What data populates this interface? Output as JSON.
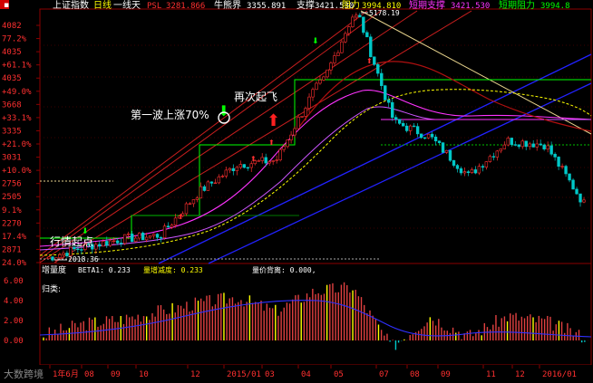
{
  "header": {
    "market": "上证指数",
    "kind": "日线",
    "period": "一线天",
    "psl_label": "PSL",
    "psl_value": "3281.866",
    "niuxiong_label": "牛熊界",
    "niuxiong_value": "3355.891",
    "support_label": "支撑",
    "support_value": "3421.530",
    "resistance_label": "阻力",
    "resistance_value": "3994.810",
    "short_support_label": "短期支撑",
    "short_support_value": "3421.530",
    "short_resist_label": "短期阻力",
    "short_resist_value": "3994.8"
  },
  "main_panel": {
    "y_ticks": [
      "4082",
      "77.2%",
      "4035",
      "61.1%",
      "4035",
      "49.0%",
      "3668",
      "33.1%",
      "3335",
      "21.0%",
      "3031",
      "10.0%",
      "2756",
      "2505",
      "9.1%",
      "2270",
      "17.4%",
      "2871",
      "24.0%"
    ],
    "annotations": {
      "wave1": "第一波上涨70%",
      "takeoff": "再次起飞",
      "start": "行情起点",
      "peak_value": "5178.19",
      "low_value": "2018.36"
    }
  },
  "sub_panel": {
    "title": "增量度",
    "beta_label": "BETA1: 0.233",
    "decrease_label": "量增减度: 0.233",
    "divergence_label": "量价背离: 0.000,",
    "class_label": "归类:",
    "y_ticks": [
      "6.00",
      "4.00",
      "2.00",
      "0.00"
    ]
  },
  "x_axis": {
    "labels": [
      "1年6月",
      "08",
      "09",
      "10",
      "12",
      "2015/01",
      "03",
      "04",
      "05",
      "07",
      "08",
      "09",
      "11",
      "12",
      "2016/01"
    ]
  },
  "watermark": "大数跨境",
  "chart_data": {
    "type": "candlestick",
    "title": "上证指数 日线",
    "x": [
      "1年6月",
      "08",
      "09",
      "10",
      "12",
      "2015/01",
      "03",
      "04",
      "05",
      "07",
      "08",
      "09",
      "11",
      "12",
      "2016/01"
    ],
    "approx_close": [
      2050,
      2200,
      2300,
      2350,
      2900,
      3250,
      3300,
      4200,
      4700,
      3800,
      3600,
      3100,
      3550,
      3500,
      2750
    ],
    "peak": 5178.19,
    "low": 2018.36,
    "volume_indicator": [
      0.4,
      1.5,
      2.0,
      2.8,
      3.6,
      4.2,
      2.8,
      4.8,
      5.2,
      -0.8,
      2.3,
      0.3,
      2.3,
      1.8,
      0.2
    ],
    "ylim": [
      2000,
      5200
    ]
  },
  "colors": {
    "bg": "#000000",
    "up": "#ff3030",
    "down": "#00c8c8",
    "frame": "#8c0000",
    "grid": "#3a0000",
    "green_line": "#00ff00",
    "yellow": "#ffff00",
    "magenta": "#ff33ff",
    "blue": "#2222ff",
    "channel_red": "#c81e1e",
    "khaki": "#e6d28c",
    "white": "#ffffff",
    "purple": "#cc55ff"
  }
}
